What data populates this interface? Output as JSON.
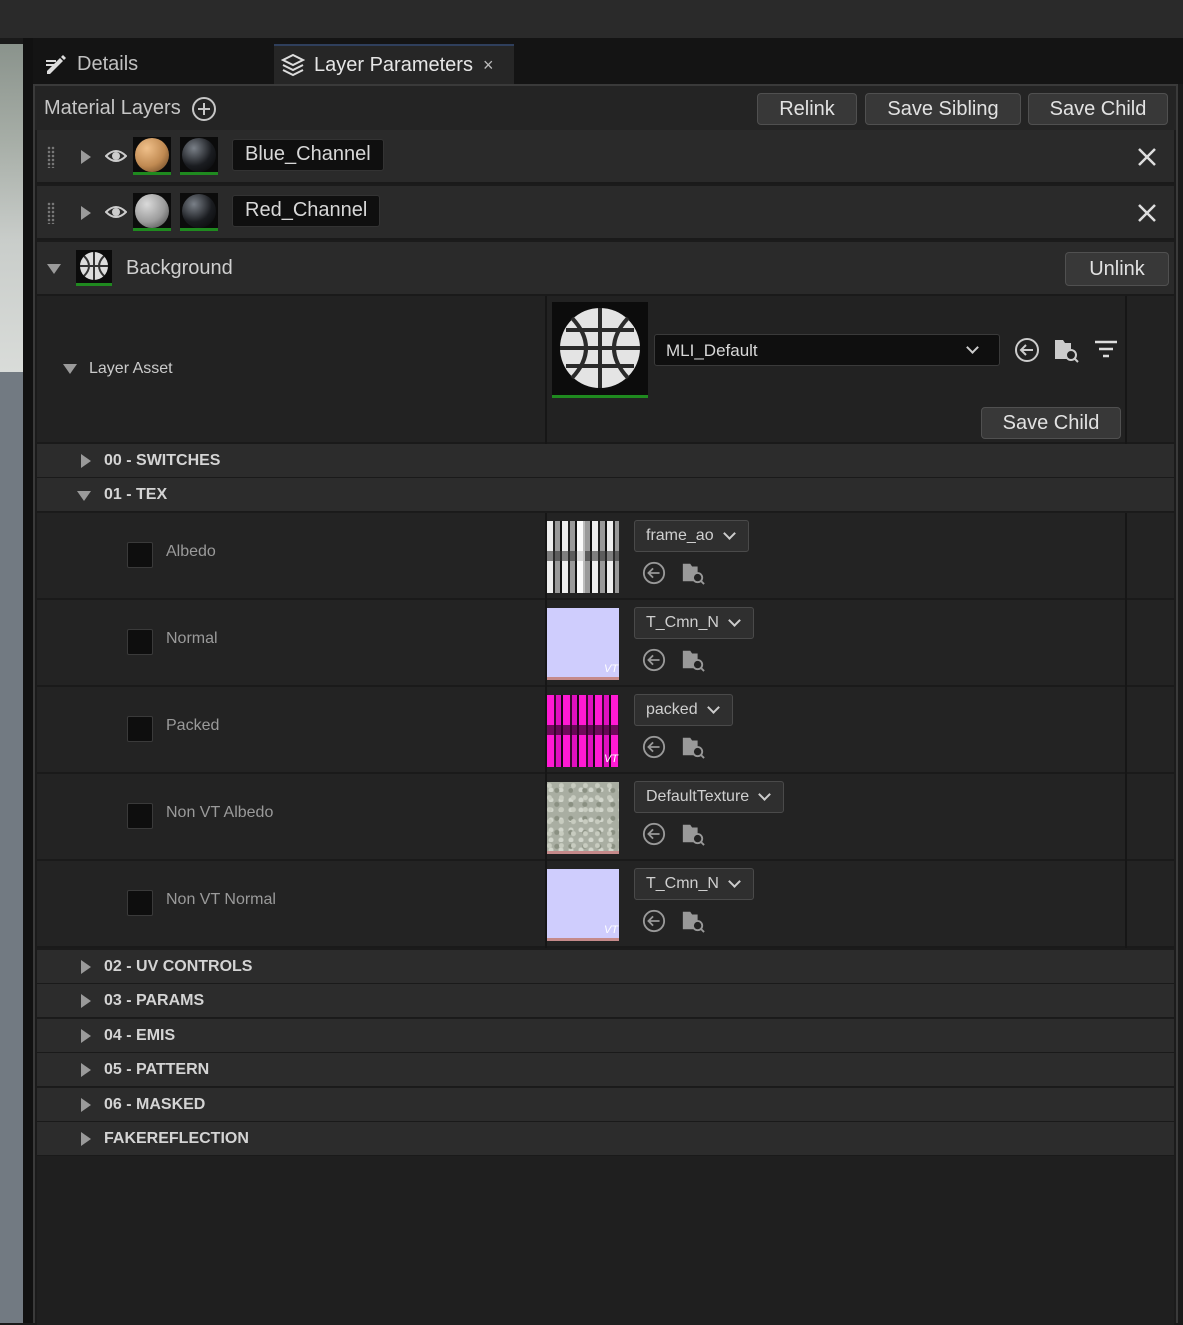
{
  "tabs": {
    "details": "Details",
    "layer_parameters": "Layer Parameters",
    "close_glyph": "×"
  },
  "header": {
    "title": "Material Layers",
    "relink": "Relink",
    "save_sibling": "Save Sibling",
    "save_child": "Save Child"
  },
  "layers": [
    {
      "name": "Blue_Channel",
      "sphere_color": "#c08a52"
    },
    {
      "name": "Red_Channel",
      "sphere_color": "#9c9c9c"
    }
  ],
  "background": {
    "label": "Background",
    "unlink": "Unlink",
    "layer_asset_label": "Layer Asset",
    "asset_value": "MLI_Default",
    "save_child": "Save Child"
  },
  "categories_top": [
    {
      "label": "00 - SWITCHES"
    },
    {
      "label": "01 - TEX"
    }
  ],
  "textures": [
    {
      "label": "Albedo",
      "value": "frame_ao",
      "vt": ""
    },
    {
      "label": "Normal",
      "value": "T_Cmn_N",
      "vt": "VT"
    },
    {
      "label": "Packed",
      "value": "packed",
      "vt": "VT"
    },
    {
      "label": "Non VT Albedo",
      "value": "DefaultTexture",
      "vt": ""
    },
    {
      "label": "Non VT Normal",
      "value": "T_Cmn_N",
      "vt": "VT"
    }
  ],
  "categories_bottom": [
    {
      "label": "02 - UV CONTROLS"
    },
    {
      "label": "03 - PARAMS"
    },
    {
      "label": "04 - EMIS"
    },
    {
      "label": "05 - PATTERN"
    },
    {
      "label": "06 - MASKED"
    },
    {
      "label": "FAKEREFLECTION"
    }
  ],
  "icons": {
    "details_tab": "pencil-icon",
    "layer_tab": "layers-icon",
    "add": "plus-circle-icon",
    "visibility": "eye-icon",
    "remove": "close-icon",
    "reset": "reset-arrow-icon",
    "browse": "browse-folder-icon",
    "filter": "filter-icon"
  },
  "colors": {
    "accent_green": "#1f8a1f",
    "panel_bg": "#1b1b1b",
    "button_bg": "#383838"
  }
}
